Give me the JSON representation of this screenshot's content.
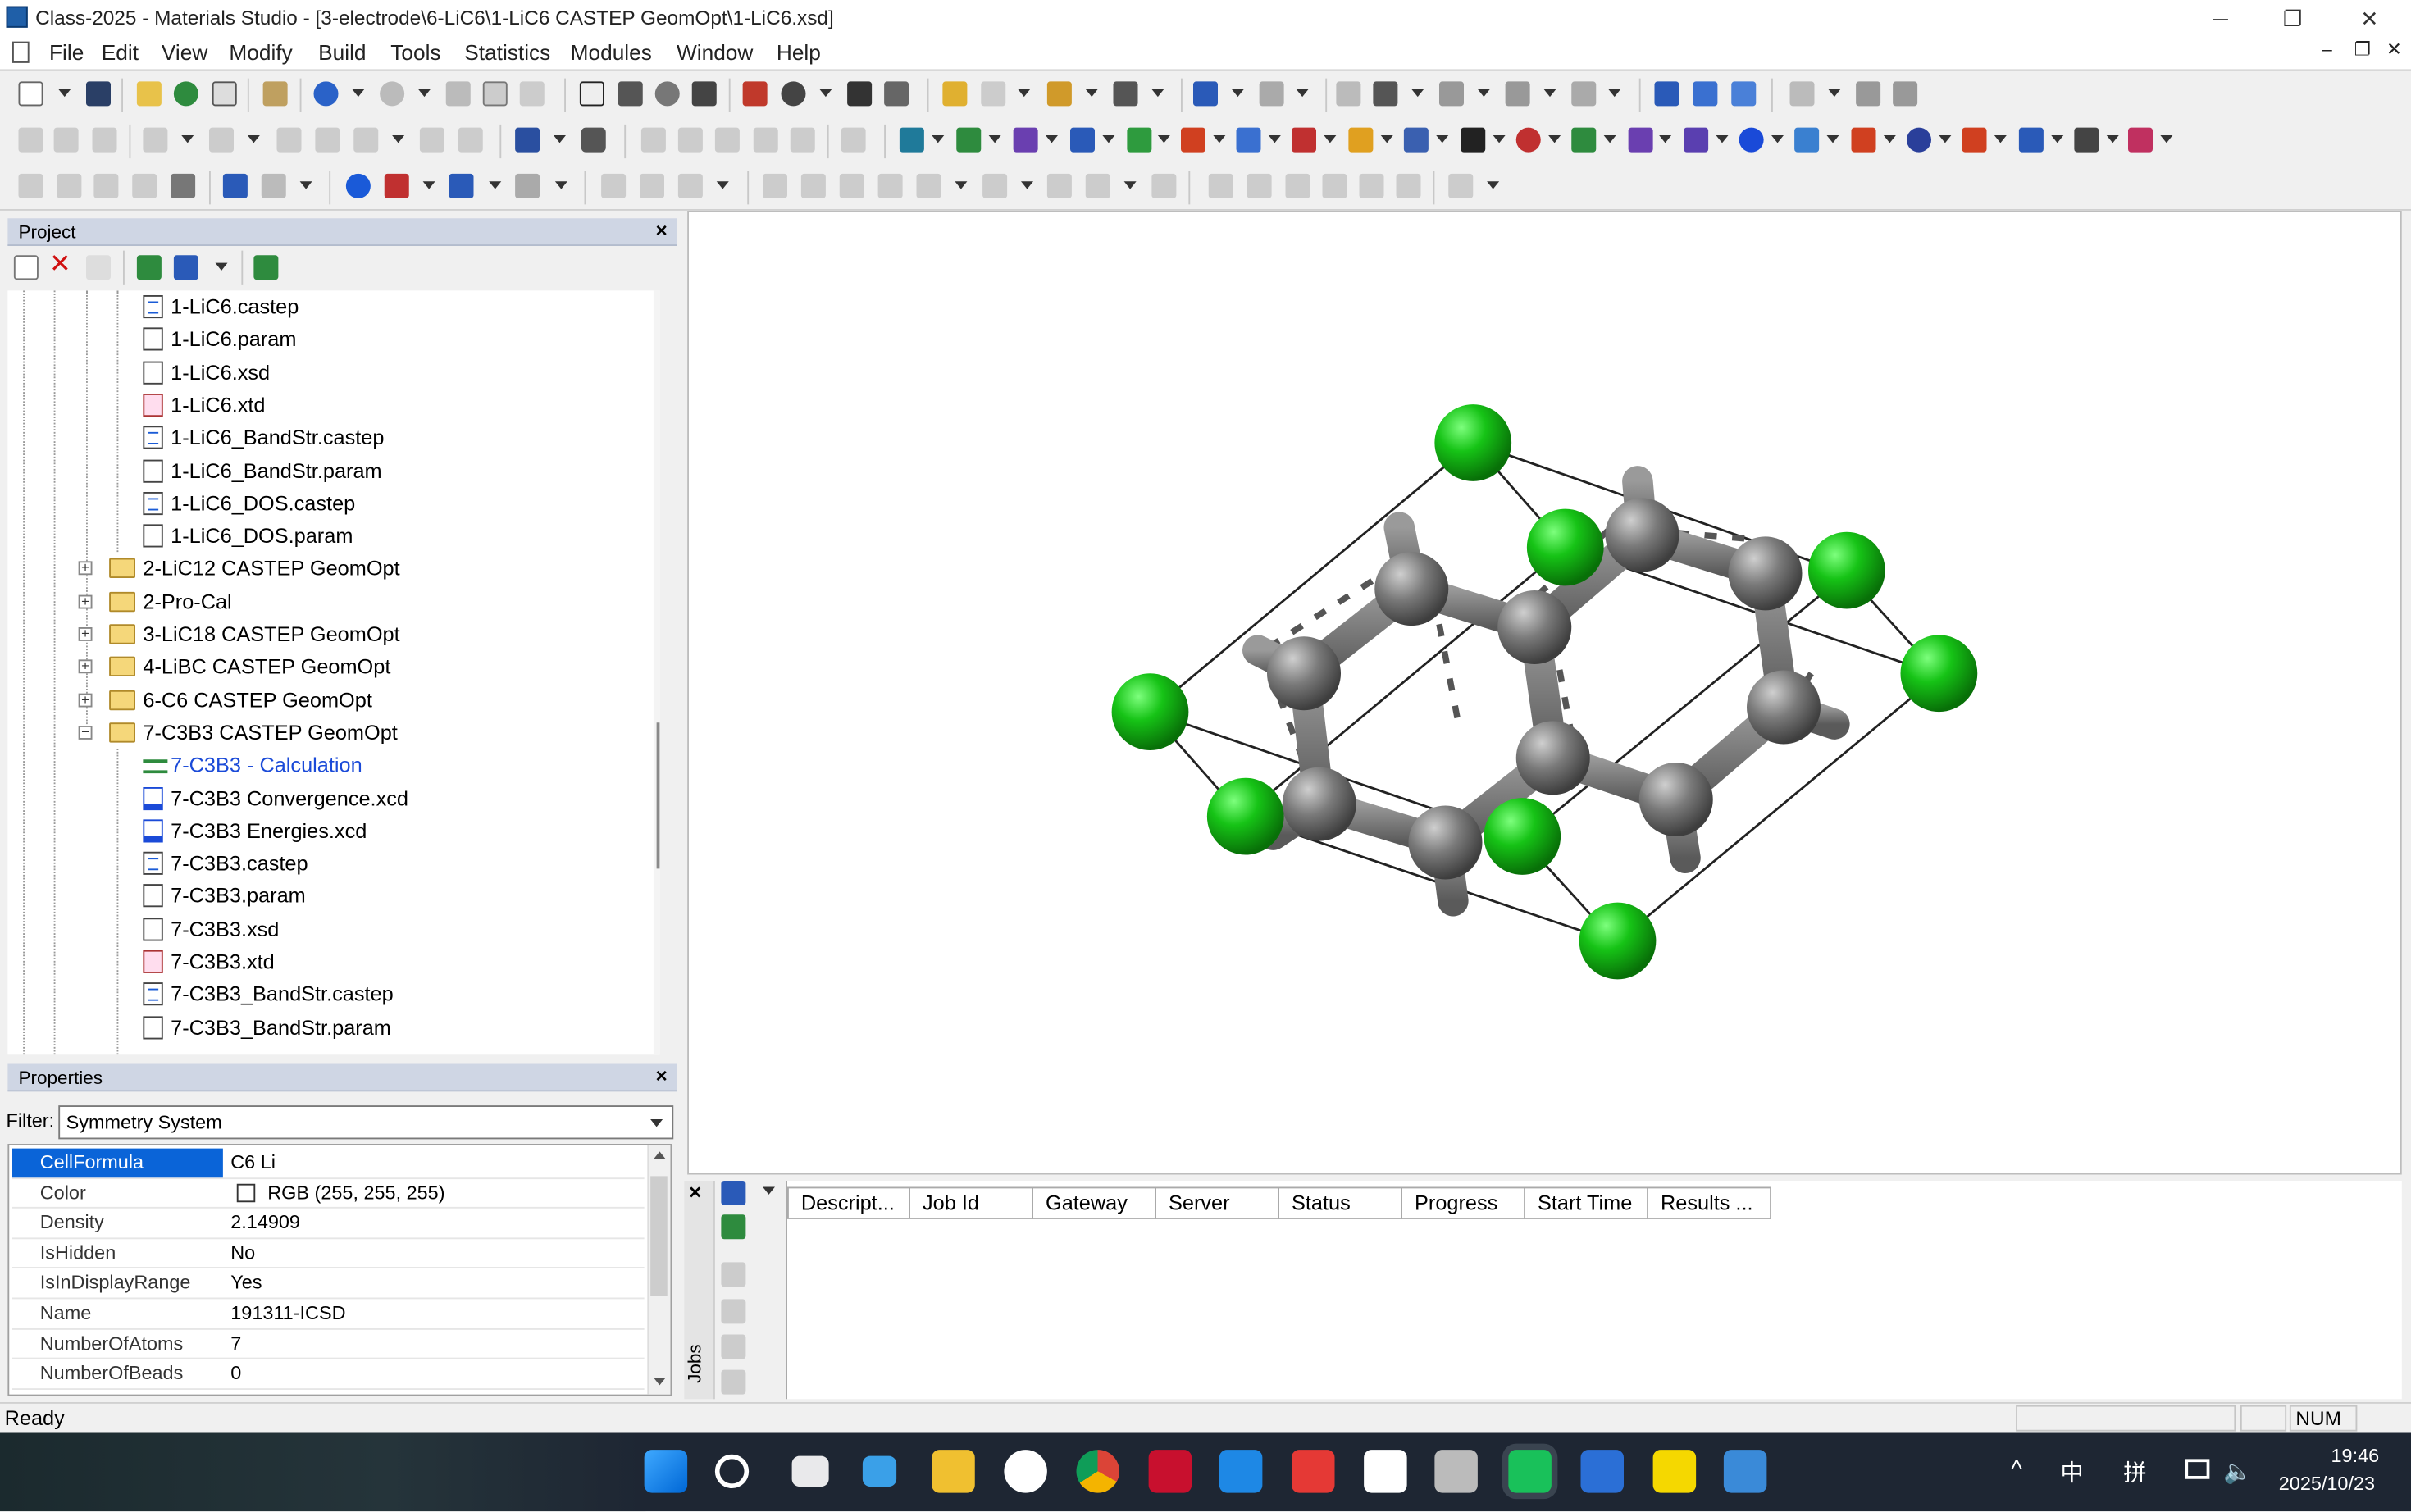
{
  "window": {
    "title": "Class-2025 - Materials Studio - [3-electrode\\6-LiC6\\1-LiC6 CASTEP GeomOpt\\1-LiC6.xsd]",
    "minimize": "─",
    "restore": "❐",
    "close": "✕"
  },
  "menu": [
    "File",
    "Edit",
    "View",
    "Modify",
    "Build",
    "Tools",
    "Statistics",
    "Modules",
    "Window",
    "Help"
  ],
  "mdi": {
    "minimize": "–",
    "restore": "❐",
    "close": "✕"
  },
  "project": {
    "title": "Project",
    "close": "×",
    "items": [
      {
        "label": "1-LiC6.castep",
        "type": "castep"
      },
      {
        "label": "1-LiC6.param",
        "type": "param"
      },
      {
        "label": "1-LiC6.xsd",
        "type": "param"
      },
      {
        "label": "1-LiC6.xtd",
        "type": "xtd"
      },
      {
        "label": "1-LiC6_BandStr.castep",
        "type": "castep"
      },
      {
        "label": "1-LiC6_BandStr.param",
        "type": "param"
      },
      {
        "label": "1-LiC6_DOS.castep",
        "type": "castep"
      },
      {
        "label": "1-LiC6_DOS.param",
        "type": "param"
      },
      {
        "label": "2-LiC12 CASTEP GeomOpt",
        "type": "folder"
      },
      {
        "label": "2-Pro-Cal",
        "type": "folder"
      },
      {
        "label": "3-LiC18 CASTEP GeomOpt",
        "type": "folder"
      },
      {
        "label": "4-LiBC CASTEP GeomOpt",
        "type": "folder"
      },
      {
        "label": "6-C6 CASTEP GeomOpt",
        "type": "folder"
      },
      {
        "label": "7-C3B3 CASTEP GeomOpt",
        "type": "folder-open"
      },
      {
        "label": "7-C3B3 - Calculation",
        "type": "calc"
      },
      {
        "label": "7-C3B3 Convergence.xcd",
        "type": "chart"
      },
      {
        "label": "7-C3B3 Energies.xcd",
        "type": "chart"
      },
      {
        "label": "7-C3B3.castep",
        "type": "castep"
      },
      {
        "label": "7-C3B3.param",
        "type": "param"
      },
      {
        "label": "7-C3B3.xsd",
        "type": "param"
      },
      {
        "label": "7-C3B3.xtd",
        "type": "xtd"
      },
      {
        "label": "7-C3B3_BandStr.castep",
        "type": "castep"
      },
      {
        "label": "7-C3B3_BandStr.param",
        "type": "param"
      }
    ]
  },
  "properties": {
    "title": "Properties",
    "close": "×",
    "filter_label": "Filter:",
    "filter_value": "Symmetry System",
    "rows": [
      {
        "key": "CellFormula",
        "value": "C6 Li"
      },
      {
        "key": "Color",
        "value": "RGB (255, 255, 255)"
      },
      {
        "key": "Density",
        "value": "2.14909"
      },
      {
        "key": "IsHidden",
        "value": "No"
      },
      {
        "key": "IsInDisplayRange",
        "value": "Yes"
      },
      {
        "key": "Name",
        "value": "191311-ICSD"
      },
      {
        "key": "NumberOfAtoms",
        "value": "7"
      },
      {
        "key": "NumberOfBeads",
        "value": "0"
      }
    ]
  },
  "jobs": {
    "side_label": "Jobs",
    "close": "×",
    "columns": [
      "Descript...",
      "Job Id",
      "Gateway",
      "Server",
      "Status",
      "Progress",
      "Start Time",
      "Results ..."
    ]
  },
  "status": {
    "text": "Ready",
    "num": "NUM"
  },
  "tray": {
    "chevron": "^",
    "ime1": "中",
    "ime2": "拼",
    "time": "19:46",
    "date": "2025/10/23"
  },
  "colors": {
    "lithium": "#13b313",
    "carbon": "#7a7a7a",
    "selection": "#0a64d8",
    "panel_header": "#cfd6e4"
  }
}
